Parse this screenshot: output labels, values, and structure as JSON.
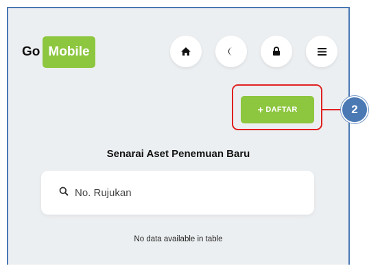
{
  "header": {
    "logo": {
      "part1": "Go",
      "part2": "Mobile"
    },
    "icons": [
      {
        "name": "home-icon"
      },
      {
        "name": "moon-icon"
      },
      {
        "name": "lock-icon"
      },
      {
        "name": "menu-icon"
      }
    ]
  },
  "actions": {
    "add_label": "DAFTAR",
    "add_icon": "+"
  },
  "callout": {
    "number": "2"
  },
  "main": {
    "title": "Senarai Aset Penemuan Baru",
    "search": {
      "placeholder": "No. Rujukan",
      "value": ""
    },
    "empty_message": "No data available in table"
  },
  "colors": {
    "brand_green": "#8dc63f",
    "background": "#eceff1",
    "highlight_red": "#e02020",
    "badge_blue": "#4a79b4"
  }
}
